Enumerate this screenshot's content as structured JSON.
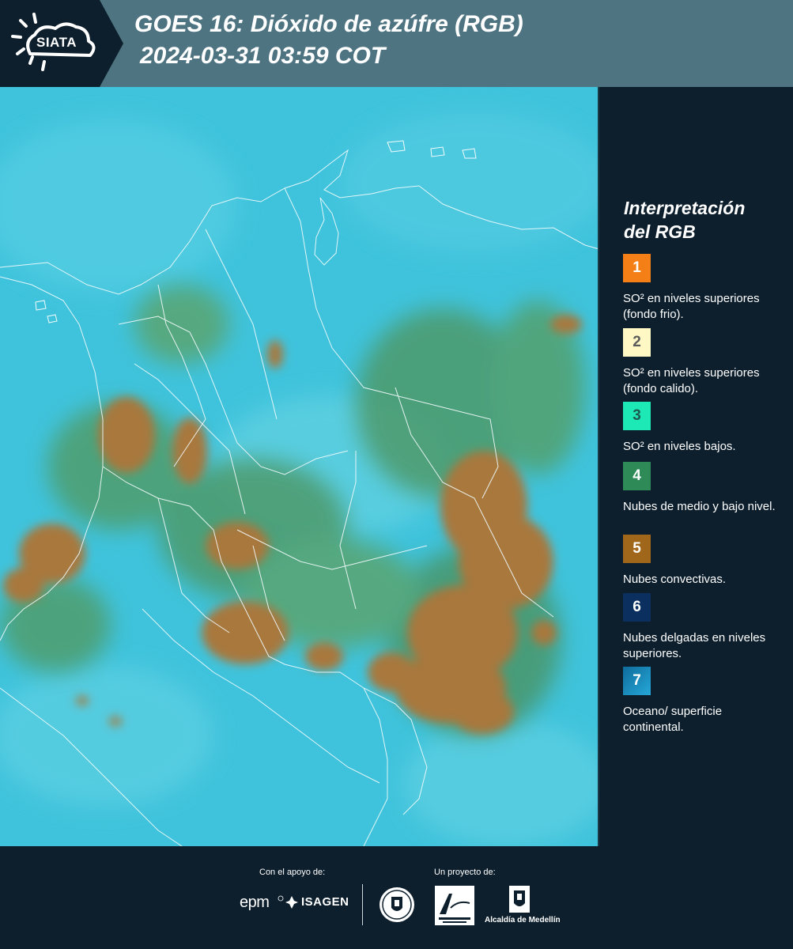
{
  "header": {
    "logo_text": "SIATA",
    "title_line1": "GOES 16: Dióxido de azúfre (RGB)",
    "title_line2": "2024-03-31 03:59 COT"
  },
  "legend": {
    "title_line1": "Interpretación",
    "title_line2": "del RGB",
    "items": [
      {
        "number": "1",
        "color": "#f57f17",
        "text": "SO² en niveles superiores (fondo frio)."
      },
      {
        "number": "2",
        "color": "#fff8c4",
        "text": "SO² en niveles superiores (fondo calido)."
      },
      {
        "number": "3",
        "color": "#1de9b6",
        "text": "SO² en niveles bajos."
      },
      {
        "number": "4",
        "color": "#2e8b57",
        "text": "Nubes de medio y bajo nivel."
      },
      {
        "number": "5",
        "color": "#a0661a",
        "text": "Nubes convectivas."
      },
      {
        "number": "6",
        "color": "#0b2f5e",
        "text": "Nubes delgadas en niveles superiores."
      },
      {
        "number": "7",
        "color": "#1b8fc2",
        "text": "Oceano/ superficie continental."
      }
    ]
  },
  "footer": {
    "support_label": "Con el apoyo de:",
    "project_label": "Un proyecto de:",
    "epm_label": "epm",
    "isagen_label": "ISAGEN",
    "alcaldia_label": "Alcaldía de Medellín"
  },
  "colors": {
    "header_bg": "#4e7482",
    "dark_bg": "#0d1f2d",
    "map_background": "#3fc6e0",
    "convective": "#a8783c",
    "midlow_cloud": "#4d9a6a"
  }
}
